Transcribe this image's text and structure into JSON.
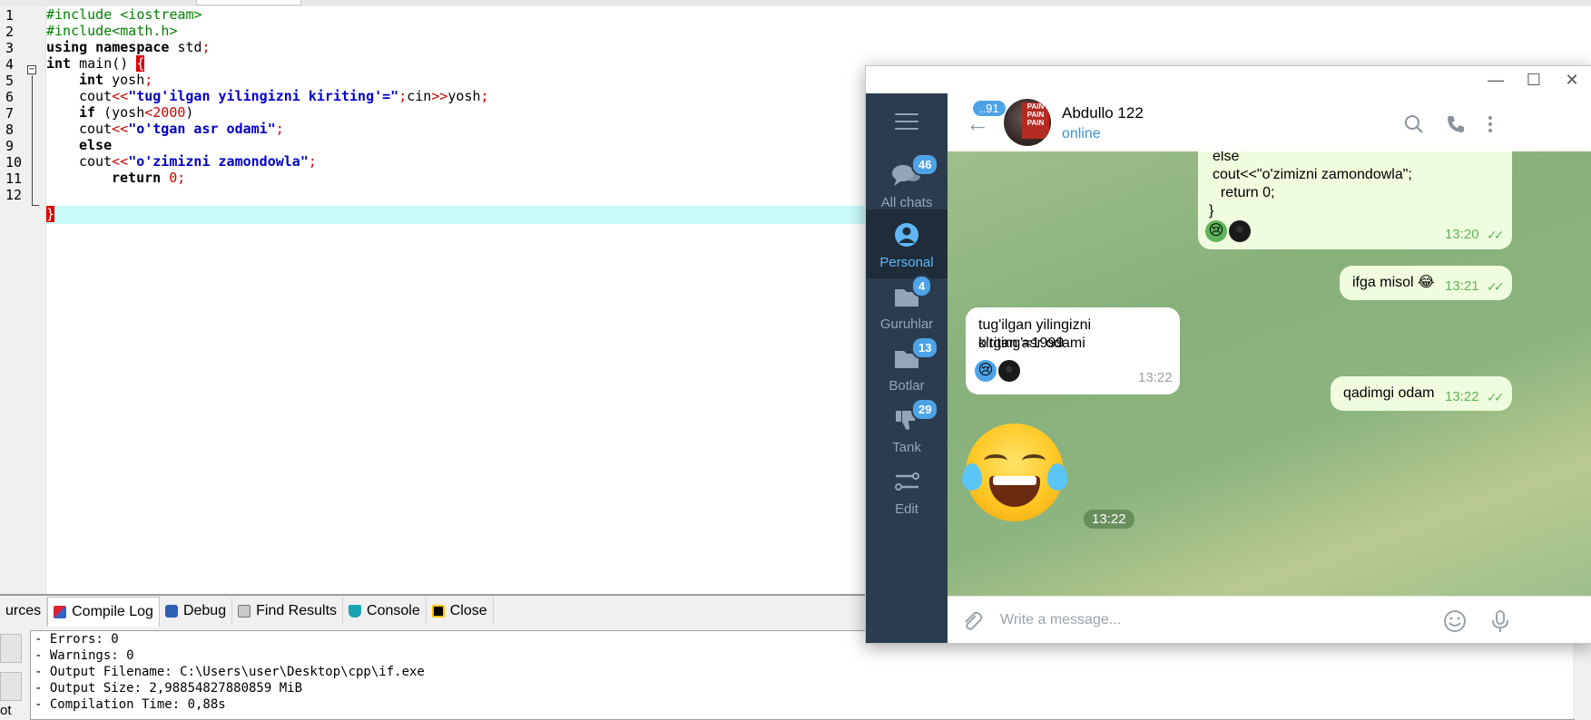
{
  "editor": {
    "line_numbers": [
      "1",
      "2",
      "3",
      "4",
      "5",
      "6",
      "7",
      "8",
      "9",
      "10",
      "11",
      "12"
    ],
    "lines": {
      "l1": "#include <iostream>",
      "l2": "#include<math.h>",
      "l3_kw": "using namespace",
      "l3_rest": " std",
      "l3_semi": ";",
      "l4_kw": "int",
      "l4_rest": " main() ",
      "l4_brace": "{",
      "l5_kw": "int",
      "l5_rest": " yosh",
      "l5_semi": ";",
      "l6_a": "cout",
      "l6_op1": "<<",
      "l6_str": "\"tug'ilgan yilingizni kiriting'=\"",
      "l6_semi1": ";",
      "l6_b": "cin",
      "l6_op2": ">>",
      "l6_c": "yosh",
      "l6_semi2": ";",
      "l7_kw": "if",
      "l7_a": " (yosh",
      "l7_op": "<",
      "l7_num": "2000",
      "l7_b": ")",
      "l8_a": "cout",
      "l8_op": "<<",
      "l8_str": "\"o'tgan asr odami\"",
      "l8_semi": ";",
      "l9_kw": "else",
      "l10_a": "cout",
      "l10_op": "<<",
      "l10_str": "\"o'zimizni zamondowla\"",
      "l10_semi": ";",
      "l11_kw": "return",
      "l11_num": " 0",
      "l11_semi": ";",
      "l12_brace": "}"
    },
    "fold_symbol": "−"
  },
  "bottom_panel": {
    "tabs": [
      {
        "label": "urces",
        "icon": "resources-icon"
      },
      {
        "label": "Compile Log",
        "icon": "compile-log-icon"
      },
      {
        "label": "Debug",
        "icon": "debug-icon"
      },
      {
        "label": "Find Results",
        "icon": "find-results-icon"
      },
      {
        "label": "Console",
        "icon": "console-icon"
      },
      {
        "label": "Close",
        "icon": "close-panel-icon"
      }
    ],
    "log_lines": [
      "- Errors: 0",
      "- Warnings: 0",
      "- Output Filename: C:\\Users\\user\\Desktop\\cpp\\if.exe",
      "- Output Size: 2,98854827880859 MiB",
      "- Compilation Time: 0,88s"
    ],
    "side_fragment": "ot"
  },
  "telegram": {
    "window_buttons": {
      "minimize": "—",
      "maximize": "☐",
      "close": "✕"
    },
    "folders": [
      {
        "label": "All chats",
        "badge": "46",
        "icon": "chats-icon"
      },
      {
        "label": "Personal",
        "badge": "",
        "icon": "person-icon"
      },
      {
        "label": "Guruhlar",
        "badge": "4",
        "icon": "folder-icon"
      },
      {
        "label": "Botlar",
        "badge": "13",
        "icon": "folder-icon"
      },
      {
        "label": "Tank",
        "badge": "29",
        "icon": "dislike-icon"
      },
      {
        "label": "Edit",
        "badge": "",
        "icon": "edit-sliders-icon"
      }
    ],
    "header": {
      "back_badge": "..91",
      "contact_name": "Abdullo 122",
      "status": "online",
      "avatar_text": "PAIN PAIN PAIN"
    },
    "messages": [
      {
        "dir": "out",
        "lines": [
          "else",
          "cout<<\"o'zimizni zamondowla\";",
          "  return 0;",
          "}"
        ],
        "time": "13:20",
        "reactions": [
          "😢",
          "⚫"
        ]
      },
      {
        "dir": "out",
        "lines": [
          "ifga misol 😂"
        ],
        "time": "13:21"
      },
      {
        "dir": "in",
        "lines": [
          "tug'ilgan yilingizni kiriting'=1999",
          "o'tgan asr odami"
        ],
        "time": "13:22",
        "reactions": [
          "😢",
          "⚫"
        ]
      },
      {
        "dir": "out",
        "lines": [
          "qadimgi odam"
        ],
        "time": "13:22"
      },
      {
        "dir": "sticker",
        "emoji": "😂",
        "time": "13:22"
      }
    ],
    "composer": {
      "placeholder": "Write a message..."
    },
    "colors": {
      "sidebar": "#2b3c4e",
      "accent": "#4da3e6",
      "outgoing_bubble": "#effdde",
      "tick": "#5fb45b"
    }
  }
}
